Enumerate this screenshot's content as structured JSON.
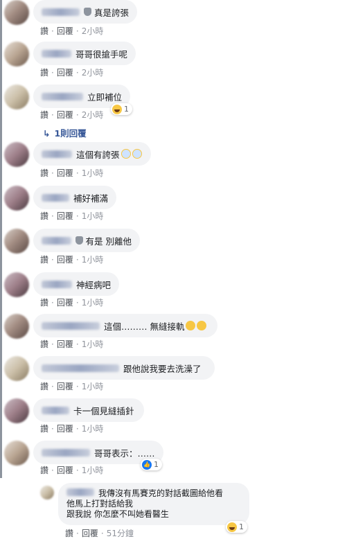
{
  "actions": {
    "like": "讚",
    "reply": "回覆"
  },
  "comments": [
    {
      "text": "真是誇張",
      "time": "2小時"
    },
    {
      "text": "哥哥很搶手呢",
      "time": "2小時"
    },
    {
      "text": "立即補位",
      "time": "2小時",
      "reaction_count": "1"
    },
    {
      "text": "這個有誇張",
      "time": "1小時"
    },
    {
      "text": "補好補滿",
      "time": "1小時"
    },
    {
      "text": "有是 別離他",
      "time": "1小時"
    },
    {
      "text": "神經病吧",
      "time": "1小時"
    },
    {
      "text": "這個……… 無縫接軌",
      "time": "1小時"
    },
    {
      "text": "跟他說我要去洗澡了",
      "time": "1小時"
    },
    {
      "text": "卡一個見縫插針",
      "time": "1小時"
    },
    {
      "text": "哥哥表示：……",
      "time": "1小時",
      "reaction_count": "1"
    }
  ],
  "replies_link": "1則回覆",
  "reply_comment": {
    "lines": [
      "我傳沒有馬賽克的對話截圖給他看",
      "他馬上打對話給我",
      "跟我說 你怎麼不叫她看醫生"
    ],
    "time": "51分鐘",
    "reaction_count": "1"
  },
  "colors": {
    "link": "#385898",
    "bubble": "#f2f3f5",
    "like": "#1877f2",
    "haha": "#f7c744"
  }
}
